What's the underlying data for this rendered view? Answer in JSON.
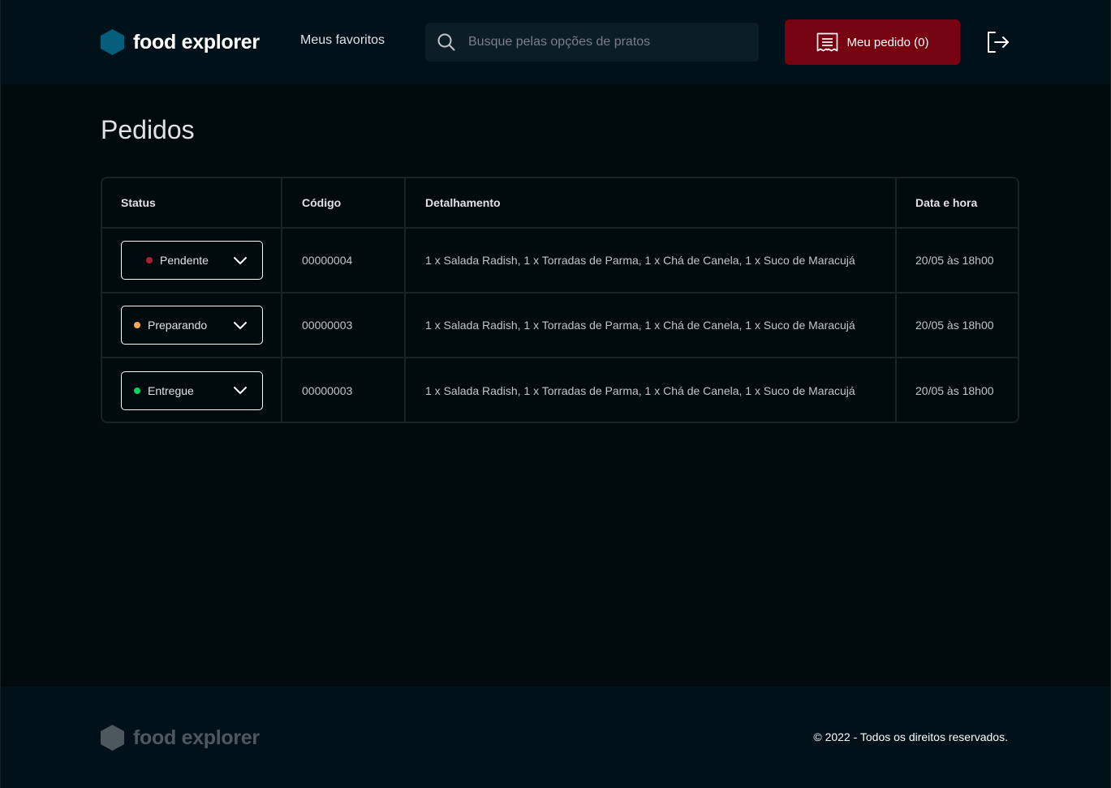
{
  "brand": {
    "name": "food explorer"
  },
  "header": {
    "favorites_label": "Meus favoritos",
    "search_placeholder": "Busque pelas opções de pratos",
    "order_button_label": "Meu pedido (0)"
  },
  "page": {
    "title": "Pedidos"
  },
  "table": {
    "headers": [
      "Status",
      "Código",
      "Detalhamento",
      "Data e hora"
    ],
    "rows": [
      {
        "status": "Pendente",
        "status_color": "#ab222e",
        "code": "00000004",
        "details": "1 x Salada Radish, 1 x Torradas de Parma, 1 x Chá de Canela, 1 x Suco de Maracujá",
        "datetime": "20/05 às 18h00"
      },
      {
        "status": "Preparando",
        "status_color": "#fba94c",
        "code": "00000003",
        "details": "1 x Salada Radish, 1 x Torradas de Parma, 1 x Chá de Canela, 1 x Suco de Maracujá",
        "datetime": "20/05 às 18h00"
      },
      {
        "status": "Entregue",
        "status_color": "#04d361",
        "code": "00000003",
        "details": "1 x Salada Radish, 1 x Torradas de Parma, 1 x Chá de Canela, 1 x Suco de Maracujá",
        "datetime": "20/05 às 18h00"
      }
    ]
  },
  "footer": {
    "brand_name": "food explorer",
    "copyright": "© 2022 - Todos os direitos reservados."
  },
  "colors": {
    "accent": "#750310",
    "brand_hex": "#065e7c",
    "footer_brand": "#4d585e"
  },
  "icons": [
    "hexagon-logo-icon",
    "search-icon",
    "receipt-icon",
    "sign-out-icon",
    "chevron-down-icon",
    "status-dot-icon"
  ]
}
